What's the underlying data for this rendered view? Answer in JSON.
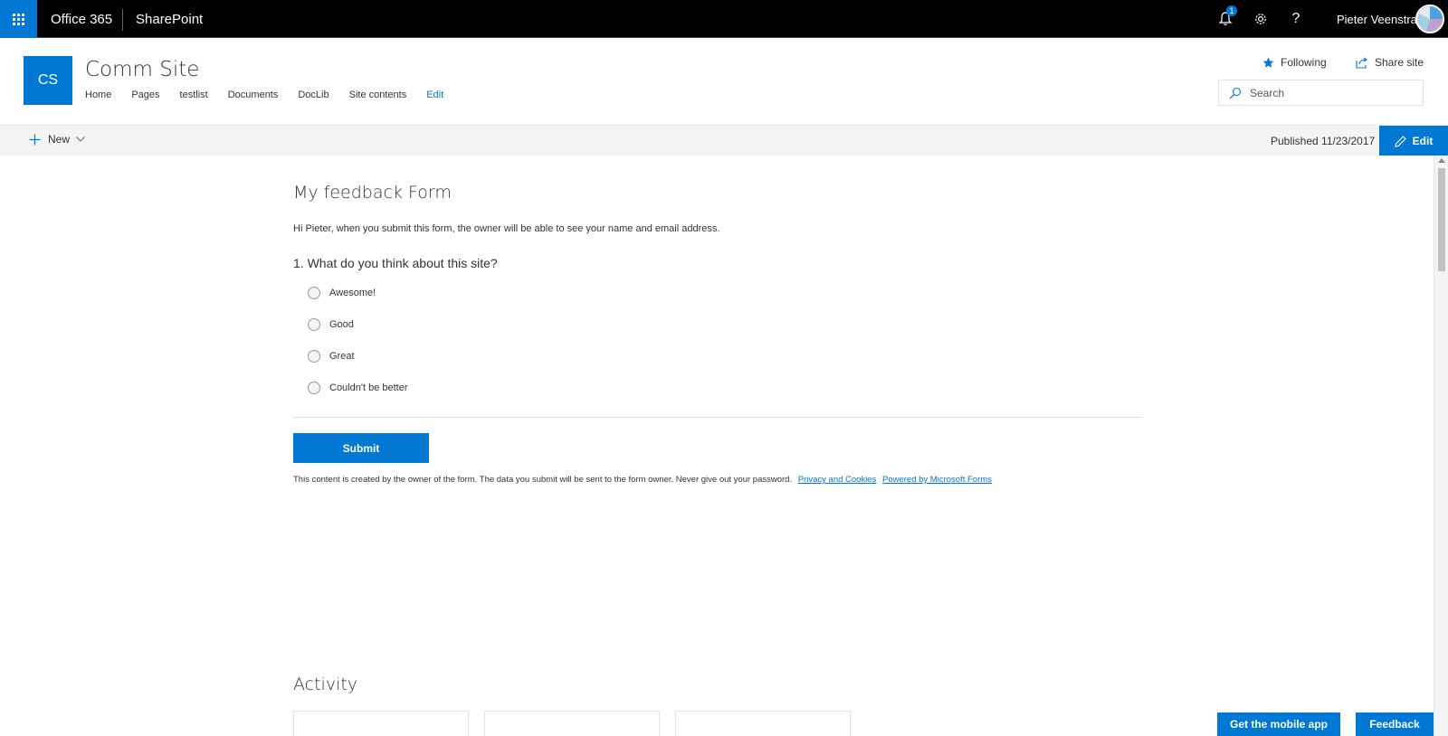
{
  "suitebar": {
    "brand": "Office 365",
    "app": "SharePoint",
    "notification_count": "1",
    "user_name": "Pieter Veenstra",
    "icons": [
      "waffle-icon",
      "bell-icon",
      "gear-icon",
      "help-icon"
    ],
    "help_glyph": "?"
  },
  "site": {
    "logo_text": "CS",
    "title": "Comm Site",
    "nav": [
      "Home",
      "Pages",
      "testlist",
      "Documents",
      "DocLib",
      "Site contents"
    ],
    "nav_edit": "Edit",
    "following_label": "Following",
    "share_label": "Share site",
    "search_placeholder": "Search"
  },
  "commandbar": {
    "new_label": "New",
    "published": "Published 11/23/2017",
    "edit_label": "Edit"
  },
  "form": {
    "title": "My feedback Form",
    "intro": "Hi Pieter, when you submit this form, the owner will be able to see your name and email address.",
    "question": "1. What do you think about this site?",
    "options": [
      "Awesome!",
      "Good",
      "Great",
      "Couldn't be better"
    ],
    "submit_label": "Submit",
    "disclaimer": "This content is created by the owner of the form. The data you submit will be sent to the form owner. Never give out your password.",
    "privacy_link": "Privacy and Cookies",
    "powered_link": "Powered by Microsoft Forms"
  },
  "activity": {
    "title": "Activity"
  },
  "footer": {
    "mobile_app_label": "Get the mobile app",
    "feedback_label": "Feedback"
  },
  "colors": {
    "accent": "#0078d4",
    "suitebar": "#000000",
    "commandbar": "#f4f4f4"
  }
}
